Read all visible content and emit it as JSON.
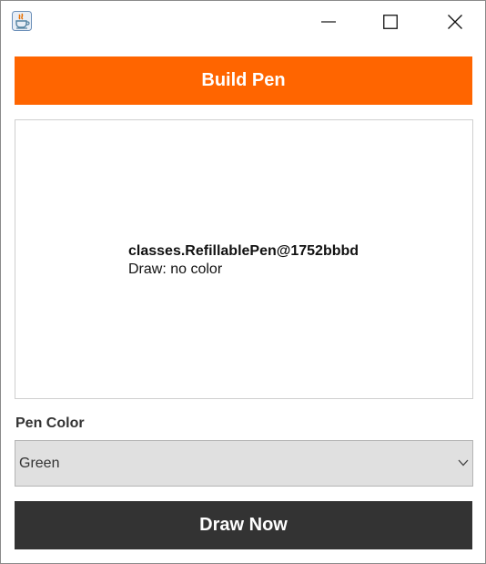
{
  "window": {
    "icon": "java-icon",
    "controls": {
      "minimize_icon": "minimize-icon",
      "maximize_icon": "maximize-icon",
      "close_icon": "close-icon"
    }
  },
  "toolbar": {
    "build_label": "Build Pen",
    "build_color": "#ff6500"
  },
  "display": {
    "pen_object": "classes.RefillablePen@1752bbbd",
    "draw_status": "Draw: no color"
  },
  "pen_color": {
    "label": "Pen Color",
    "selected": "Green",
    "icon": "chevron-down-icon"
  },
  "actions": {
    "draw_label": "Draw Now",
    "draw_color": "#333333"
  }
}
